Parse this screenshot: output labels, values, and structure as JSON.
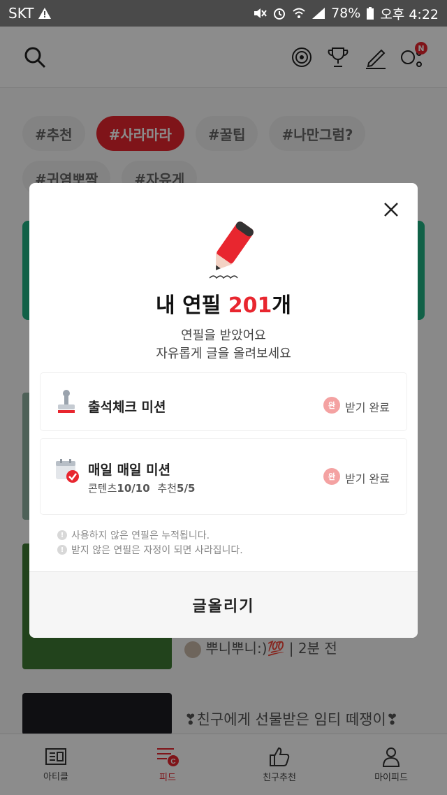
{
  "status_bar": {
    "carrier": "SKT",
    "battery": "78%",
    "time": "오후 4:22"
  },
  "tags": [
    "#추천",
    "#사라마라",
    "#꿀팁",
    "#나만그럼?",
    "#귀염뽀짝",
    "#자유게"
  ],
  "feed": {
    "author": "뿌니뿌니:)💯",
    "time_ago": "2분 전",
    "post_title": "❣친구에게 선물받은 임티 떼쟁이❣"
  },
  "bottom_nav": [
    "아티클",
    "피드",
    "친구추천",
    "마이피드"
  ],
  "modal": {
    "title_prefix": "내 연필 ",
    "count": "201",
    "title_suffix": "개",
    "line1": "연필을 받았어요",
    "line2": "자유롭게 글을 올려보세요",
    "missions": [
      {
        "title": "출석체크 미션",
        "badge": "완",
        "status": "받기 완료"
      },
      {
        "title": "매일 매일 미션",
        "sub_label1": "콘텐츠",
        "sub_value1": "10/10",
        "sub_label2": "추천",
        "sub_value2": "5/5",
        "badge": "완",
        "status": "받기 완료"
      }
    ],
    "notes": [
      "사용하지 않은 연필은 누적됩니다.",
      "받지 않은 연필은 자정이 되면 사라집니다."
    ],
    "note_icon": "!",
    "button": "글올리기"
  },
  "colors": {
    "accent": "#e8262f",
    "green": "#1fb181"
  }
}
